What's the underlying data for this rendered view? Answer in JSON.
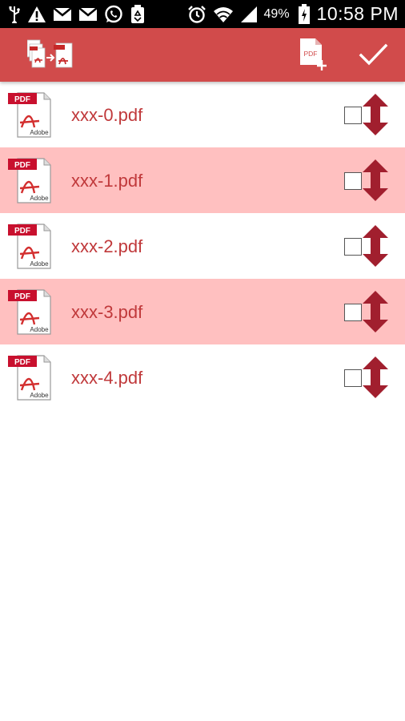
{
  "status_bar": {
    "battery_percent": "49%",
    "time": "10:58 PM",
    "icons": [
      "usb-icon",
      "warning-icon",
      "gmail-icon",
      "gmail-icon",
      "whatsapp-icon",
      "recycle-icon",
      "alarm-icon",
      "wifi-icon",
      "signal-icon",
      "battery-icon"
    ]
  },
  "app_bar": {
    "logo_icon": "pdf-merge-logo-icon",
    "actions": [
      {
        "name": "add-pdf-button",
        "icon": "pdf-add-icon",
        "label": "PDF"
      },
      {
        "name": "confirm-button",
        "icon": "checkmark-icon"
      }
    ]
  },
  "colors": {
    "accent": "#d14b4b",
    "row_alt": "#ffc0c0",
    "file_name": "#c0393b",
    "handle": "#a11f2e"
  },
  "files": [
    {
      "name": "xxx-0.pdf",
      "checked": false
    },
    {
      "name": "xxx-1.pdf",
      "checked": false
    },
    {
      "name": "xxx-2.pdf",
      "checked": false
    },
    {
      "name": "xxx-3.pdf",
      "checked": false
    },
    {
      "name": "xxx-4.pdf",
      "checked": false
    }
  ],
  "pdf_icon_labels": {
    "top": "PDF",
    "bottom": "Adobe"
  }
}
